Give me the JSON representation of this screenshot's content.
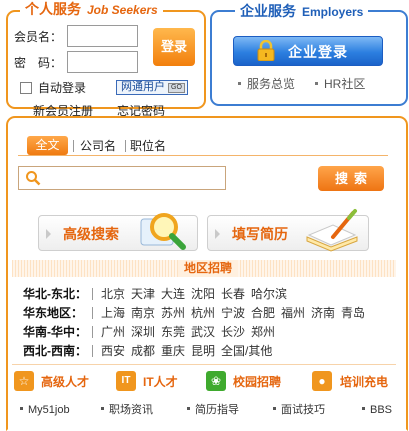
{
  "jobseekers": {
    "title_cn": "个人服务",
    "title_en": "Job Seekers",
    "username_label": "会员名：",
    "password_label": "密　码：",
    "login_button": "登录",
    "auto_login": "自动登录",
    "net_pass": "网通用户",
    "net_pass_go": "GO",
    "register": "新会员注册",
    "forgot": "忘记密码"
  },
  "employers": {
    "title_cn": "企业服务",
    "title_en": "Employers",
    "login_button": "企业登录",
    "links": [
      "服务总览",
      "HR社区"
    ]
  },
  "search": {
    "tabs": [
      "全文",
      "公司名",
      "职位名"
    ],
    "active_tab": 0,
    "query": "",
    "search_button": "搜索"
  },
  "feature_buttons": [
    "高级搜索",
    "填写简历"
  ],
  "regions": {
    "header": "地区招聘",
    "rows": [
      {
        "name": "华北-东北：",
        "cities": [
          "北京",
          "天津",
          "大连",
          "沈阳",
          "长春",
          "哈尔滨"
        ]
      },
      {
        "name": "华东地区：",
        "cities": [
          "上海",
          "南京",
          "苏州",
          "杭州",
          "宁波",
          "合肥",
          "福州",
          "济南",
          "青岛"
        ]
      },
      {
        "name": "华南-华中：",
        "cities": [
          "广州",
          "深圳",
          "东莞",
          "武汉",
          "长沙",
          "郑州"
        ]
      },
      {
        "name": "西北-西南：",
        "cities": [
          "西安",
          "成都",
          "重庆",
          "昆明",
          "全国/其他"
        ]
      }
    ]
  },
  "categories": [
    {
      "label": "高级人才",
      "icon": "star-icon",
      "color": "#f0961e",
      "glyph": "☆"
    },
    {
      "label": "IT人才",
      "icon": "it-icon",
      "color": "#f0961e",
      "glyph": "IT"
    },
    {
      "label": "校园招聘",
      "icon": "campus-icon",
      "color": "#3faa2e",
      "glyph": "❀"
    },
    {
      "label": "培训充电",
      "icon": "training-icon",
      "color": "#f0961e",
      "glyph": "●"
    }
  ],
  "bottom_links": [
    "My51job",
    "职场资讯",
    "简历指导",
    "面试技巧",
    "BBS"
  ],
  "colors": {
    "orange": "#f0961e",
    "blue": "#3c7dd2",
    "accent_text": "#e5660f"
  }
}
